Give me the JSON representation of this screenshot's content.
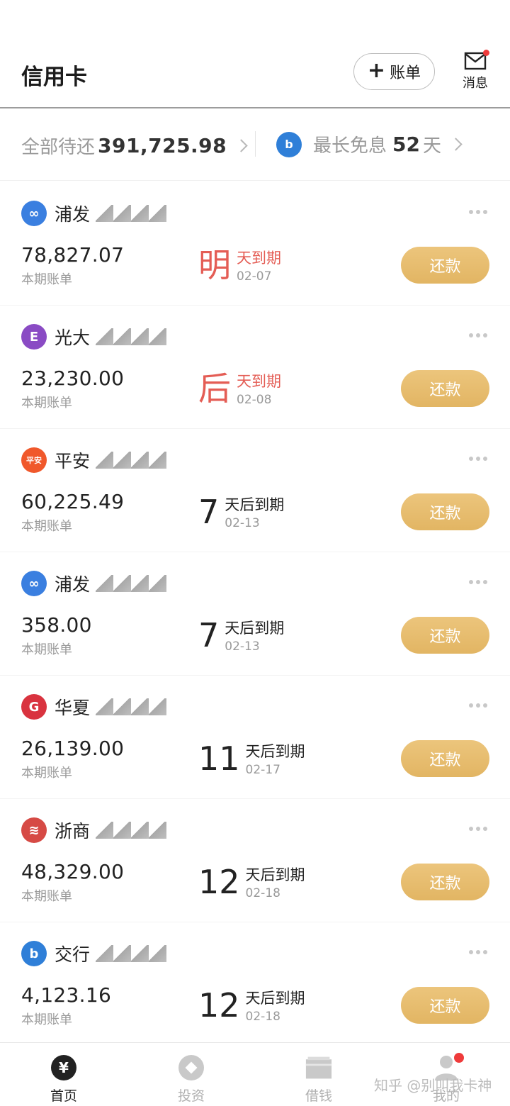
{
  "header": {
    "title": "信用卡",
    "add_bill_label": "账单",
    "message_label": "消息"
  },
  "summary": {
    "total_label": "全部待还",
    "total_amount": "391,725.98",
    "free_label": "最长免息",
    "free_days": "52",
    "free_unit": "天"
  },
  "cards": [
    {
      "bank": "浦发",
      "logo_color": "#3a7fe0",
      "logo_text": "∞",
      "amount": "78,827.07",
      "sub": "本期账单",
      "due_big": "明",
      "due_text": "天到期",
      "due_date": "02-07",
      "urgent": true,
      "pay": "还款"
    },
    {
      "bank": "光大",
      "logo_color": "#8a4bc4",
      "logo_text": "E",
      "amount": "23,230.00",
      "sub": "本期账单",
      "due_big": "后",
      "due_text": "天到期",
      "due_date": "02-08",
      "urgent": true,
      "pay": "还款"
    },
    {
      "bank": "平安",
      "logo_color": "#f0582b",
      "logo_text": "平安",
      "amount": "60,225.49",
      "sub": "本期账单",
      "due_big": "7",
      "due_text": "天后到期",
      "due_date": "02-13",
      "urgent": false,
      "pay": "还款"
    },
    {
      "bank": "浦发",
      "logo_color": "#3a7fe0",
      "logo_text": "∞",
      "amount": "358.00",
      "sub": "本期账单",
      "due_big": "7",
      "due_text": "天后到期",
      "due_date": "02-13",
      "urgent": false,
      "pay": "还款"
    },
    {
      "bank": "华夏",
      "logo_color": "#d9333f",
      "logo_text": "G",
      "amount": "26,139.00",
      "sub": "本期账单",
      "due_big": "11",
      "due_text": "天后到期",
      "due_date": "02-17",
      "urgent": false,
      "pay": "还款"
    },
    {
      "bank": "浙商",
      "logo_color": "#d64a45",
      "logo_text": "≋",
      "amount": "48,329.00",
      "sub": "本期账单",
      "due_big": "12",
      "due_text": "天后到期",
      "due_date": "02-18",
      "urgent": false,
      "pay": "还款"
    },
    {
      "bank": "交行",
      "logo_color": "#2f7fd8",
      "logo_text": "b",
      "amount": "4,123.16",
      "sub": "本期账单",
      "due_big": "12",
      "due_text": "天后到期",
      "due_date": "02-18",
      "urgent": false,
      "pay": "还款"
    }
  ],
  "tabs": [
    {
      "label": "首页",
      "icon": "yen-icon",
      "active": true
    },
    {
      "label": "投资",
      "icon": "diamond-icon",
      "active": false
    },
    {
      "label": "借钱",
      "icon": "wallet-icon",
      "active": false
    },
    {
      "label": "我的",
      "icon": "user-icon",
      "active": false
    }
  ],
  "watermark": "知乎 @别叫我卡神",
  "colors": {
    "accent": "#e2b563",
    "urgent": "#e45d55",
    "badge": "#ef3b3b"
  }
}
